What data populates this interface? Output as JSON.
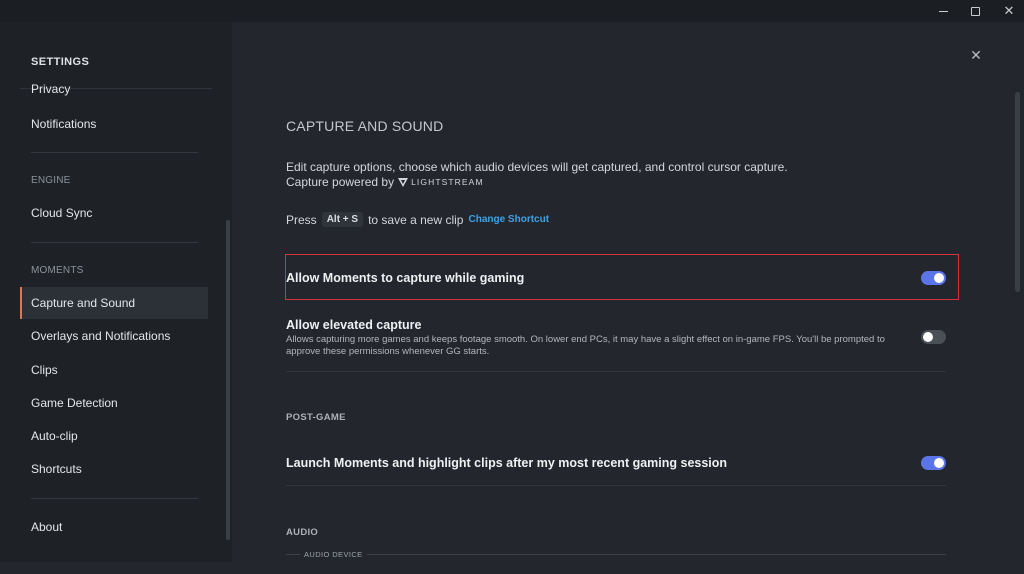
{
  "window": {
    "minimize_icon": "minimize-icon",
    "maximize_icon": "maximize-icon",
    "close_icon": "close-icon",
    "close_glyph": "✕"
  },
  "sidebar": {
    "header": "SETTINGS",
    "items_top": [
      {
        "label": "Privacy"
      },
      {
        "label": "Notifications"
      }
    ],
    "engine_section": "ENGINE",
    "engine_items": [
      {
        "label": "Cloud Sync"
      }
    ],
    "moments_section": "MOMENTS",
    "moments_items": [
      {
        "label": "Capture and Sound",
        "active": true
      },
      {
        "label": "Overlays and Notifications"
      },
      {
        "label": "Clips"
      },
      {
        "label": "Game Detection"
      },
      {
        "label": "Auto-clip"
      },
      {
        "label": "Shortcuts"
      }
    ],
    "bottom_items": [
      {
        "label": "About"
      }
    ],
    "active_accent": "#e8734a"
  },
  "main": {
    "close_glyph": "✕",
    "title": "CAPTURE AND SOUND",
    "description": "Edit capture options, choose which audio devices will get captured, and control cursor capture.",
    "powered_prefix": "Capture powered by",
    "powered_brand": "LIGHTSTREAM",
    "press_prefix": "Press",
    "shortcut_key": "Alt + S",
    "press_suffix": "to save a new clip",
    "change_shortcut": "Change Shortcut",
    "settings": {
      "allow_moments": {
        "label": "Allow Moments to capture while gaming",
        "enabled": true
      },
      "allow_elevated": {
        "label": "Allow elevated capture",
        "description": "Allows capturing more games and keeps footage smooth. On lower end PCs, it may have a slight effect on in-game FPS. You'll be prompted to approve these permissions whenever GG starts.",
        "enabled": false
      }
    },
    "post_game_section": "POST-GAME",
    "post_game": {
      "launch_moments": {
        "label": "Launch Moments and highlight clips after my most recent gaming session",
        "enabled": true
      }
    },
    "audio_section": "AUDIO",
    "audio_device_label": "AUDIO DEVICE",
    "highlight_color": "#d2343a",
    "toggle_on_color": "#5b74e8"
  }
}
